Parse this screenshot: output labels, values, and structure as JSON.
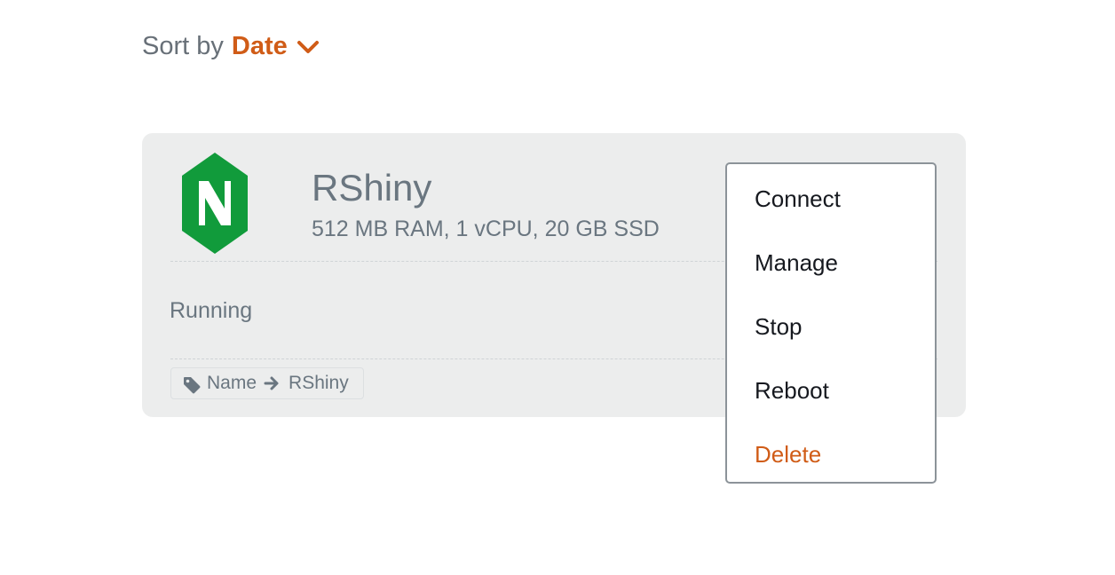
{
  "sort": {
    "label": "Sort by",
    "value": "Date",
    "icon": "chevron-down-icon"
  },
  "instance": {
    "name": "RShiny",
    "specs": "512 MB RAM, 1 vCPU, 20 GB SSD",
    "status": "Running",
    "logo_icon": "nginx-logo-icon",
    "logo_letter": "N",
    "tag": {
      "key": "Name",
      "value": "RShiny",
      "icon": "tag-icon",
      "separator_icon": "arrow-right-icon"
    }
  },
  "menu": {
    "items": [
      {
        "label": "Connect"
      },
      {
        "label": "Manage"
      },
      {
        "label": "Stop"
      },
      {
        "label": "Reboot"
      },
      {
        "label": "Delete"
      }
    ]
  },
  "colors": {
    "accent": "#d05c17",
    "text_muted": "#6a7680",
    "card_bg": "#eceded",
    "logo_green": "#119b3b"
  }
}
